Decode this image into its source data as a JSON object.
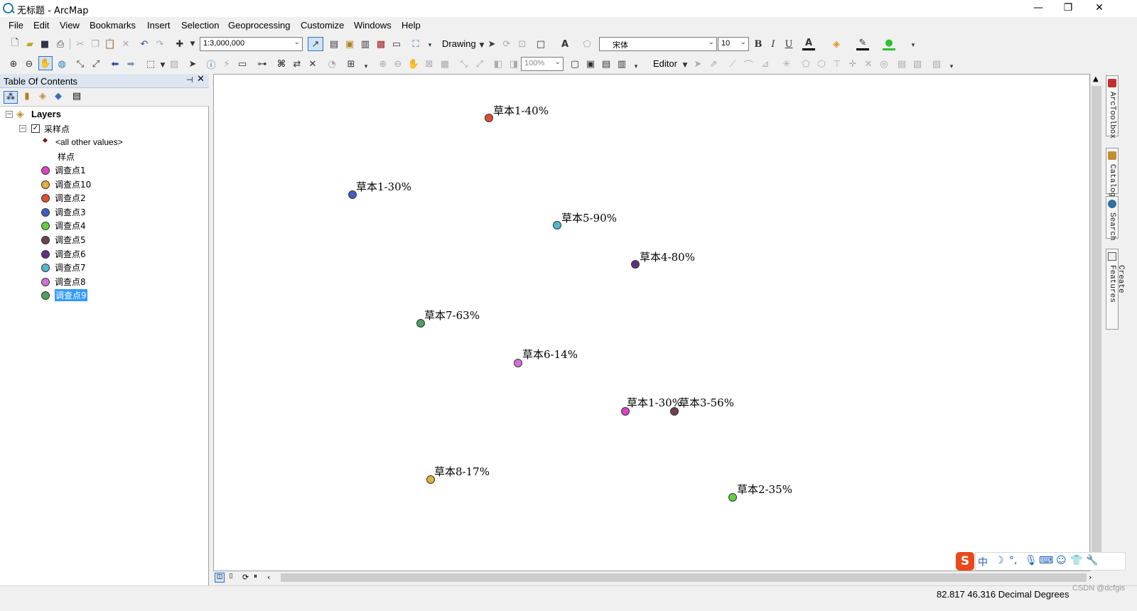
{
  "window": {
    "title": "无标题 - ArcMap",
    "minimize": "—",
    "restore": "❐",
    "close": "✕"
  },
  "menu": [
    "File",
    "Edit",
    "View",
    "Bookmarks",
    "Insert",
    "Selection",
    "Geoprocessing",
    "Customize",
    "Windows",
    "Help"
  ],
  "toolbar": {
    "scale": "1:3,000,000",
    "drawing_label": "Drawing",
    "font_name": "宋体",
    "font_size": "10",
    "bold": "B",
    "italic": "I",
    "underline": "U",
    "zoom_percent": "100%",
    "editor_label": "Editor"
  },
  "colors": {
    "toc_header": "#dde6f0",
    "selection": "#3399ff",
    "map_background": "#ffffff"
  },
  "toc": {
    "title": "Table Of Contents",
    "root_label": "Layers",
    "layer_name": "采样点",
    "other_values": "<all other values>",
    "field_name": "样点",
    "classes": [
      {
        "label": "调查点1",
        "color": "#e040c8"
      },
      {
        "label": "调查点10",
        "color": "#e0b040"
      },
      {
        "label": "调查点2",
        "color": "#e05030"
      },
      {
        "label": "调查点3",
        "color": "#4060c0"
      },
      {
        "label": "调查点4",
        "color": "#60d040"
      },
      {
        "label": "调查点5",
        "color": "#704050"
      },
      {
        "label": "调查点6",
        "color": "#603080"
      },
      {
        "label": "调查点7",
        "color": "#50b8d0"
      },
      {
        "label": "调查点8",
        "color": "#d070d8"
      },
      {
        "label": "调查点9",
        "color": "#50a060"
      }
    ],
    "selected_index": 9
  },
  "map": {
    "points": [
      {
        "label": "草本1-40%",
        "color": "#e05030"
      },
      {
        "label": "草本1-30%",
        "color": "#4060c0"
      },
      {
        "label": "草本5-90%",
        "color": "#50b8d0"
      },
      {
        "label": "草本4-80%",
        "color": "#603080"
      },
      {
        "label": "草本7-63%",
        "color": "#50a060"
      },
      {
        "label": "草本6-14%",
        "color": "#d070d8"
      },
      {
        "label": "草本1-30%",
        "color": "#e040c8"
      },
      {
        "label": "草本3-56%",
        "color": "#704050"
      },
      {
        "label": "草本8-17%",
        "color": "#e0b040"
      },
      {
        "label": "草本2-35%",
        "color": "#60d040"
      }
    ]
  },
  "dock_tabs": [
    "ArcToolbox",
    "Catalog",
    "Search",
    "Create Features"
  ],
  "status": {
    "coordinates": "82.817  46.316 Decimal Degrees",
    "watermark": "CSDN @dcfgis"
  },
  "ime": {
    "brand": "S",
    "mode": "中"
  }
}
